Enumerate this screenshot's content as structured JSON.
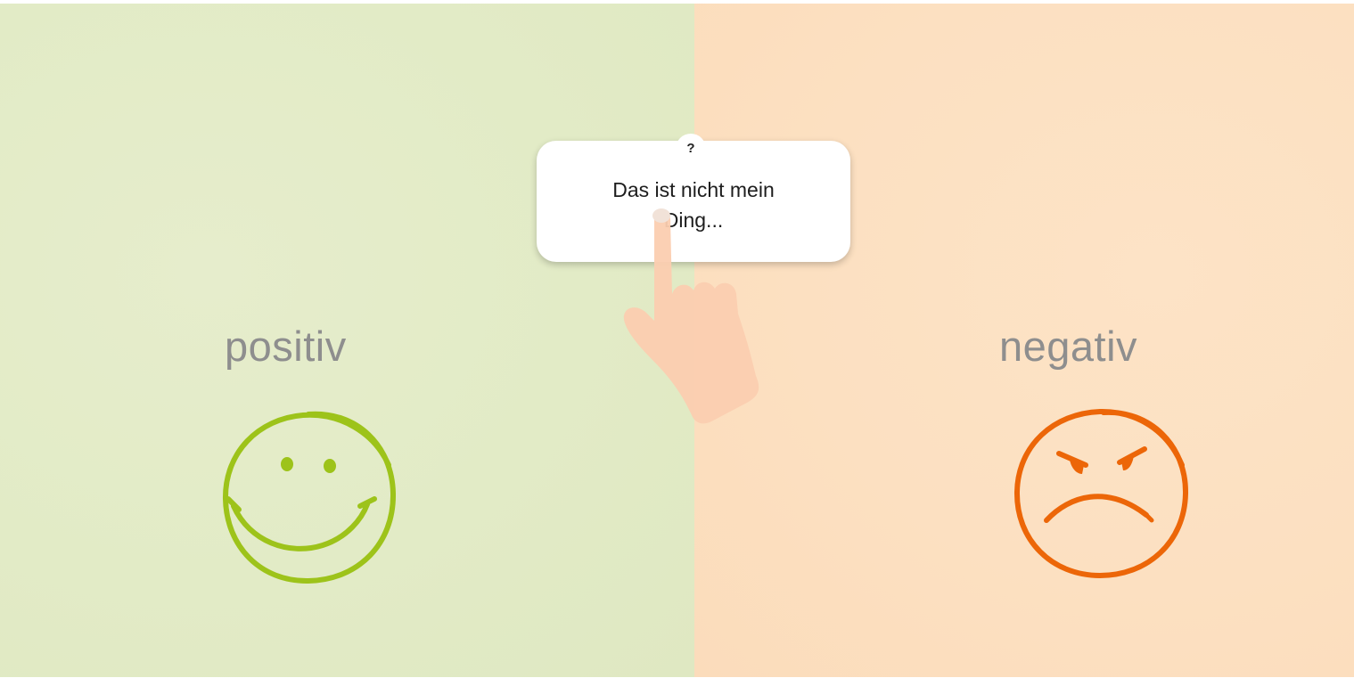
{
  "categories": {
    "positive": {
      "label": "positiv",
      "icon": "smiley-happy-icon",
      "background_color": "#e2eac5",
      "icon_color": "#9dc31a"
    },
    "negative": {
      "label": "negativ",
      "icon": "smiley-angry-icon",
      "background_color": "#fde0c2",
      "icon_color": "#ec6608"
    }
  },
  "card": {
    "help_label": "?",
    "text": "Das ist nicht mein Ding..."
  },
  "gesture": {
    "icon": "pointing-hand-icon",
    "color": "#fbcdb0"
  },
  "colors": {
    "label_text": "#8e8e8e",
    "card_background": "#ffffff",
    "card_text": "#1d1d1d"
  }
}
